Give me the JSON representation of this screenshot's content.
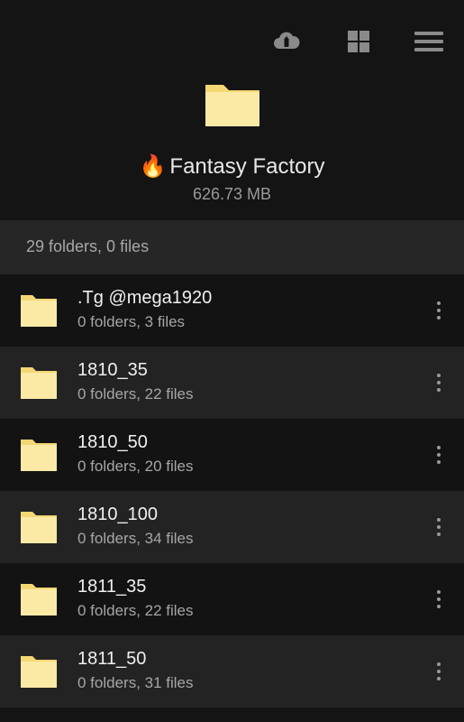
{
  "toolbar": {
    "icons": [
      "cloud-upload-icon",
      "grid-view-icon",
      "menu-icon"
    ]
  },
  "folder": {
    "title": "Fantasy Factory",
    "title_emoji": "🔥",
    "size": "626.73 MB",
    "summary": "29 folders, 0 files"
  },
  "items": [
    {
      "name": ".Tg @mega1920",
      "meta": "0 folders, 3 files"
    },
    {
      "name": "1810_35",
      "meta": "0 folders, 22 files"
    },
    {
      "name": "1810_50",
      "meta": "0 folders, 20 files"
    },
    {
      "name": "1810_100",
      "meta": "0 folders, 34 files"
    },
    {
      "name": "1811_35",
      "meta": "0 folders, 22 files"
    },
    {
      "name": "1811_50",
      "meta": "0 folders, 31 files"
    }
  ],
  "colors": {
    "background": "#141414",
    "row_alt": "#232323",
    "folder_fill": "#fbe9a6",
    "folder_tab": "#f3d774"
  }
}
